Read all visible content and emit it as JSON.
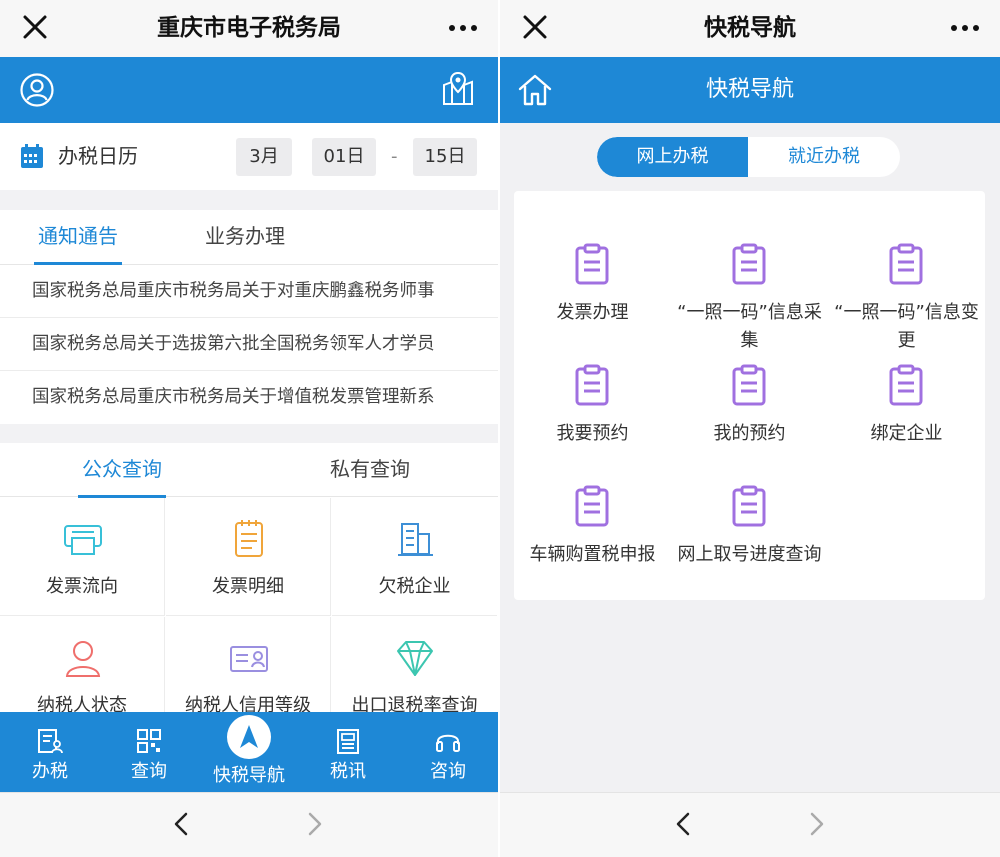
{
  "left": {
    "window_title": "重庆市电子税务局",
    "calendar": {
      "label": "办税日历",
      "month": "3月",
      "start_day": "01日",
      "separator": "-",
      "end_day": "15日"
    },
    "notice_tabs": [
      "通知通告",
      "业务办理"
    ],
    "notices": [
      "国家税务总局重庆市税务局关于对重庆鹏鑫税务师事",
      "国家税务总局关于选拔第六批全国税务领军人才学员",
      "国家税务总局重庆市税务局关于增值税发票管理新系"
    ],
    "query_tabs": [
      "公众查询",
      "私有查询"
    ],
    "query_items": [
      {
        "label": "发票流向",
        "icon": "printer-icon",
        "color": "#38c0d8"
      },
      {
        "label": "发票明细",
        "icon": "notepad-icon",
        "color": "#f0a53a"
      },
      {
        "label": "欠税企业",
        "icon": "building-icon",
        "color": "#3d8fd6"
      },
      {
        "label": "纳税人状态",
        "icon": "person-icon",
        "color": "#ef6f6c"
      },
      {
        "label": "纳税人信用等级",
        "icon": "id-card-icon",
        "color": "#9a8fe0"
      },
      {
        "label": "出口退税率查询",
        "icon": "diamond-icon",
        "color": "#3cc6b0"
      }
    ],
    "tabbar": [
      {
        "label": "办税",
        "icon": "document-person-icon"
      },
      {
        "label": "查询",
        "icon": "qr-code-icon"
      },
      {
        "label": "快税导航",
        "icon": "navigation-arrow-icon"
      },
      {
        "label": "税讯",
        "icon": "newspaper-icon"
      },
      {
        "label": "咨询",
        "icon": "headset-icon"
      }
    ],
    "accent_color": "#1e88d6"
  },
  "right": {
    "window_title": "快税导航",
    "header_title": "快税导航",
    "segments": [
      "网上办税",
      "就近办税"
    ],
    "nav_items": [
      {
        "label": "发票办理",
        "icon": "clipboard-icon"
      },
      {
        "label": "“一照一码”信息采集",
        "icon": "clipboard-icon"
      },
      {
        "label": "“一照一码”信息变更",
        "icon": "clipboard-icon"
      },
      {
        "label": "我要预约",
        "icon": "clipboard-icon"
      },
      {
        "label": "我的预约",
        "icon": "clipboard-icon"
      },
      {
        "label": "绑定企业",
        "icon": "clipboard-icon"
      },
      {
        "label": "车辆购置税申报",
        "icon": "clipboard-icon"
      },
      {
        "label": "网上取号进度查询",
        "icon": "clipboard-icon"
      }
    ],
    "icon_color": "#a070e0"
  }
}
